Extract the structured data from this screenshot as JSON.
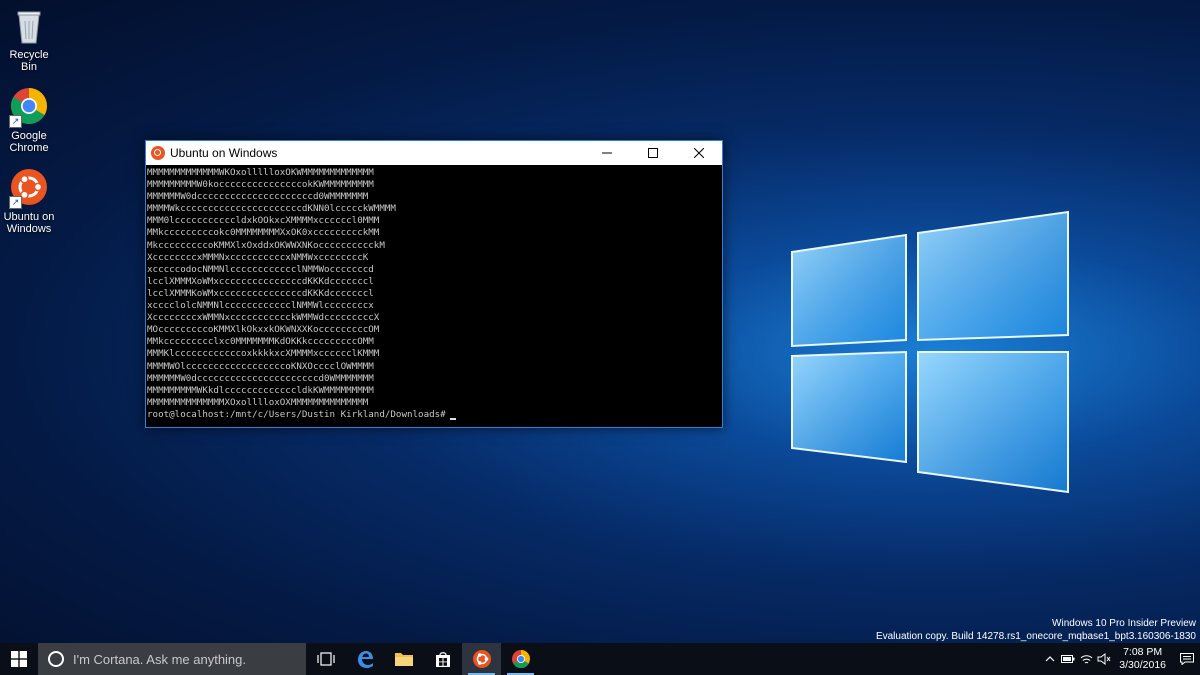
{
  "desktop": {
    "icons": [
      {
        "label": "Recycle Bin"
      },
      {
        "label": "Google Chrome"
      },
      {
        "label": "Ubuntu on Windows"
      }
    ]
  },
  "window": {
    "title": "Ubuntu on Windows",
    "lines": [
      "MMMMMMMMMMMMMWKOxollllloxOKWMMMMMMMMMMMMM",
      "MMMMMMMMMW0kocccccccccccccccokKWMMMMMMMMM",
      "MMMMMMW0dcccccccccccccccccccccd0WMMMMMMM",
      "MMMMWkccccccccccccccccccccccdKNN0lccccckWMMMM",
      "MMM0lcccccccccccldxkOOkxcXMMMMxccccccl0MMM",
      "MMkcccccccccokc0MMMMMMMMXxOK0xccccccccckMM",
      "MkcccccccccoKMMXlxOxddxOKWWXNKocccccccccckM",
      "XccccccccxMMMNxccccccccccxNMMWxccccccccK",
      "xcccccodocNMMNlcccccccccccclNMMWocccccccd",
      "lcclXMMMXoWMxcccccccccccccccdKKKdcccccccl",
      "lcclXMMMKoWMxcccccccccccccccdKKKdcccccccl",
      "xcccclolcNMMNlcccccccccccclNMMWlccccccccx",
      "XccccccccxWMMNxccccccccccckWMMWdcccccccccX",
      "MOcccccccccoKMMXlkOkxxkOKWNXXKocccccccccOM",
      "MMkccccccccclxc0MMMMMMMKdOKKkcccccccccOMM",
      "MMMKlccccccccccccoxkkkkxcXMMMMxcccccclKMMM",
      "MMMMWOlccccccccccccccccccoKNXOcccclOWMMMM",
      "MMMMMMW0dccccccccccccccccccccccd0WMMMMMMM",
      "MMMMMMMMMWKkdlcccccccccccccldkKWMMMMMMMMM",
      "MMMMMMMMMMMMMMXOxolllloxOXMMMMMMMMMMMMMM"
    ],
    "prompt": "root@localhost:/mnt/c/Users/Dustin Kirkland/Downloads#"
  },
  "watermark": {
    "line1": "Windows 10 Pro Insider Preview",
    "line2": "Evaluation copy. Build 14278.rs1_onecore_mqbase1_bpt3.160306-1830"
  },
  "taskbar": {
    "search_placeholder": "I'm Cortana. Ask me anything.",
    "time": "7:08 PM",
    "date": "3/30/2016"
  },
  "icons": [
    "windows-start-icon",
    "cortana-icon",
    "task-view-icon",
    "edge-icon",
    "file-explorer-icon",
    "store-icon",
    "ubuntu-icon",
    "chrome-icon",
    "chevron-up-icon",
    "battery-icon",
    "wifi-icon",
    "volume-icon",
    "notification-icon",
    "recycle-bin-icon"
  ],
  "colors": {
    "accent": "#2f7fd8",
    "ubuntu": "#e95420",
    "taskbar": "#0a0e17"
  }
}
